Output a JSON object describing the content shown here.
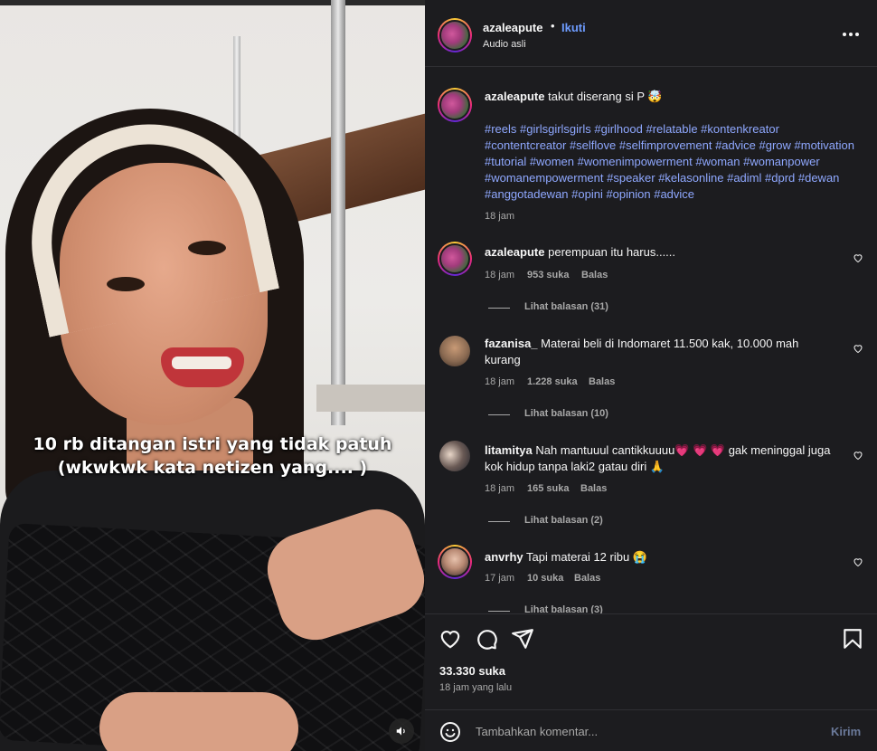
{
  "video": {
    "caption_line1": "10 rb ditangan istri yang tidak patuh",
    "caption_line2": "(wkwkwk kata netizen yang.... )",
    "mute_icon": "speaker-icon"
  },
  "header": {
    "username": "azaleapute",
    "dot": "•",
    "follow_label": "Ikuti",
    "audio_label": "Audio asli",
    "more_icon": "more-horizontal-icon"
  },
  "post": {
    "username": "azaleapute",
    "text": "takut diserang si P 🤯",
    "hashtags": "#reels #girlsgirlsgirls #girlhood #relatable #kontenkreator #contentcreator #selflove #selfimprovement #advice #grow #motivation #tutorial #women #womenimpowerment #woman #womanpower #womanempowerment #speaker #kelasonline #adiml #dprd #dewan #anggotadewan #opini #opinion #advice",
    "time": "18 jam"
  },
  "comments": [
    {
      "username": "azaleapute",
      "text": "perempuan itu harus......",
      "time": "18 jam",
      "likes": "953 suka",
      "reply_label": "Balas",
      "view_replies": "Lihat balasan (31)"
    },
    {
      "username": "fazanisa_",
      "text": "Materai beli di Indomaret 11.500 kak, 10.000 mah kurang",
      "time": "18 jam",
      "likes": "1.228 suka",
      "reply_label": "Balas",
      "view_replies": "Lihat balasan (10)"
    },
    {
      "username": "litamitya",
      "text": "Nah mantuuul cantikkuuuu💗 💗 💗  gak meninggal juga kok hidup tanpa laki2 gatau diri 🙏",
      "time": "18 jam",
      "likes": "165 suka",
      "reply_label": "Balas",
      "view_replies": "Lihat balasan (2)"
    },
    {
      "username": "anvrhy",
      "text": "Tapi materai 12 ribu 😭",
      "time": "17 jam",
      "likes": "10 suka",
      "reply_label": "Balas",
      "view_replies": "Lihat balasan (3)"
    }
  ],
  "actions": {
    "like_icon": "heart-icon",
    "comment_icon": "comment-icon",
    "share_icon": "send-icon",
    "save_icon": "bookmark-icon"
  },
  "likes_total": "33.330 suka",
  "posted_ago": "18 jam yang lalu",
  "comment_box": {
    "placeholder": "Tambahkan komentar...",
    "send_label": "Kirim",
    "emoji_icon": "emoji-icon"
  },
  "colors": {
    "panel_bg": "#1c1c1f",
    "link": "#6e9cff",
    "hashtag": "#8fa8ff",
    "muted": "#a8a8a8"
  }
}
